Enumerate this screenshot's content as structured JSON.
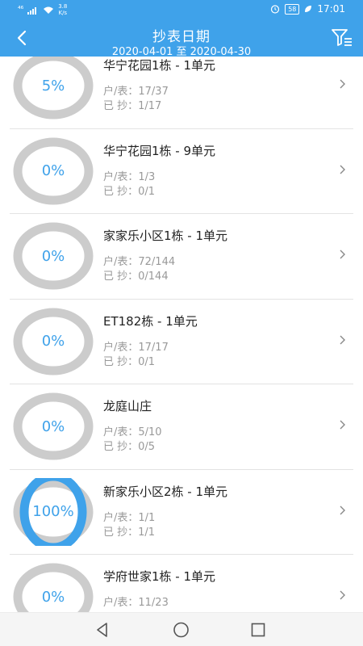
{
  "status": {
    "network": "⁴⁶",
    "speed_value": "3.8",
    "speed_unit": "K/s",
    "battery": "58",
    "time": "17:01"
  },
  "header": {
    "title": "抄表日期",
    "date_range": "2020-04-01 至 2020-04-30"
  },
  "colors": {
    "accent": "#3fa2ea",
    "ring_track": "#cccccc"
  },
  "items": [
    {
      "title": "华宁花园1栋 - 1单元",
      "percent_label": "5%",
      "percent": 5,
      "households": "户/表：17/37",
      "read": "已 抄：1/17"
    },
    {
      "title": "华宁花园1栋 - 9单元",
      "percent_label": "0%",
      "percent": 0,
      "households": "户/表：1/3",
      "read": "已 抄：0/1"
    },
    {
      "title": "家家乐小区1栋 - 1单元",
      "percent_label": "0%",
      "percent": 0,
      "households": "户/表：72/144",
      "read": "已 抄：0/144"
    },
    {
      "title": "ET182栋 - 1单元",
      "percent_label": "0%",
      "percent": 0,
      "households": "户/表：17/17",
      "read": "已 抄：0/1"
    },
    {
      "title": "龙庭山庄",
      "percent_label": "0%",
      "percent": 0,
      "households": "户/表：5/10",
      "read": "已 抄：0/5"
    },
    {
      "title": "新家乐小区2栋 - 1单元",
      "percent_label": "100%",
      "percent": 100,
      "households": "户/表：1/1",
      "read": "已 抄：1/1"
    },
    {
      "title": "学府世家1栋 - 1单元",
      "percent_label": "0%",
      "percent": 0,
      "households": "户/表：11/23",
      "read": ""
    }
  ]
}
